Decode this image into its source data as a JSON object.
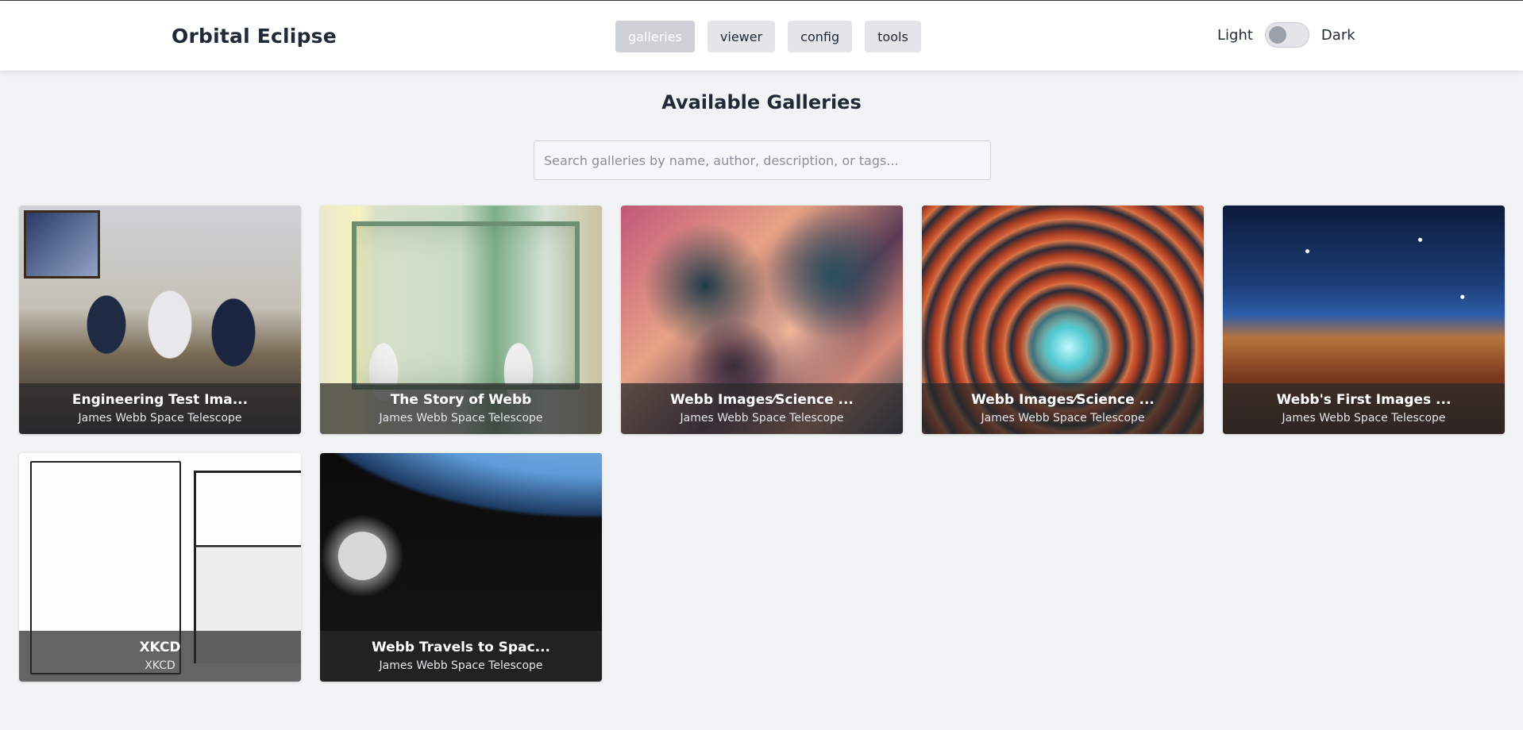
{
  "app": {
    "title": "Orbital Eclipse"
  },
  "nav": {
    "items": [
      {
        "label": "galleries",
        "active": true
      },
      {
        "label": "viewer",
        "active": false
      },
      {
        "label": "config",
        "active": false
      },
      {
        "label": "tools",
        "active": false
      }
    ]
  },
  "theme_toggle": {
    "light_label": "Light",
    "dark_label": "Dark",
    "mode": "light"
  },
  "main": {
    "heading": "Available Galleries",
    "search": {
      "placeholder": "Search galleries by name, author, description, or tags...",
      "value": ""
    },
    "galleries": [
      {
        "title": "Engineering Test Ima...",
        "author": "James Webb Space Telescope",
        "thumb": "meeting-photo"
      },
      {
        "title": "The Story of Webb",
        "author": "James Webb Space Telescope",
        "thumb": "cleanroom-photo"
      },
      {
        "title": "Webb Images⁄Science ...",
        "author": "James Webb Space Telescope",
        "thumb": "nebula-image"
      },
      {
        "title": "Webb Images⁄Science ...",
        "author": "James Webb Space Telescope",
        "thumb": "spiral-galaxy-image"
      },
      {
        "title": "Webb's First Images ...",
        "author": "James Webb Space Telescope",
        "thumb": "cosmic-cliffs-image"
      },
      {
        "title": "XKCD",
        "author": "XKCD",
        "thumb": "comic-image"
      },
      {
        "title": "Webb Travels to Spac...",
        "author": "James Webb Space Telescope",
        "thumb": "earth-departure-image"
      }
    ]
  },
  "colors": {
    "background": "#f1f3f5",
    "header": "#ffffff",
    "button": "#e3e5e8",
    "button_active": "#cdd1d6",
    "caption_overlay": "rgba(40,40,40,0.72)"
  }
}
